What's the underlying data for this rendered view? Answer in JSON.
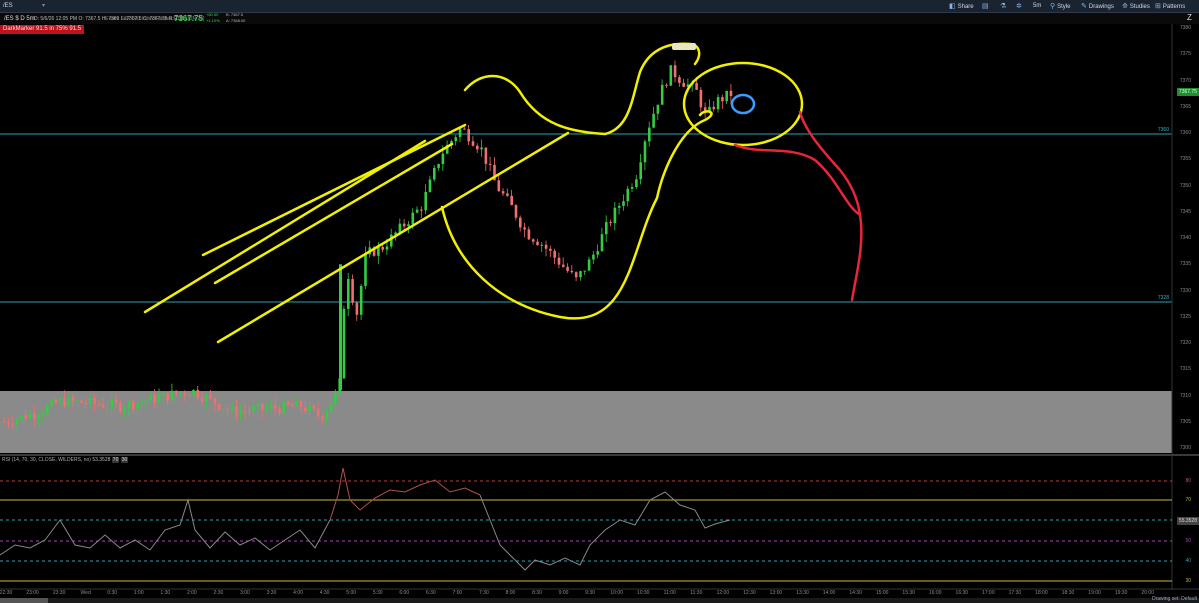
{
  "toolbar": {
    "symbol": "/ES",
    "share": "Share",
    "style": "Style",
    "drawings": "Drawings",
    "studies": "Studies",
    "patterns": "Patterns",
    "timeframe": "5m"
  },
  "header": {
    "symbol": "/ES $ D 5m",
    "ohlc": "D: 5/6/26 12:05 PM   O: 7367.5   H: 7369   L: 7367.5   C: 7367.75   R: 1.5",
    "description": "E-mini S&P 500 Index Futures,ETH [JUN 26]",
    "last_price": "7367.75",
    "change_up": "+80.50",
    "change_down": "+1.10%",
    "bid": "B: 7367.5",
    "ask": "A: 7368.00"
  },
  "study_badge": "DarkMarker 91.5 in 75% 91.5",
  "price_axis": [
    "7380",
    "7375",
    "7370",
    "7365",
    "7360",
    "7355",
    "7350",
    "7345",
    "7340",
    "7335",
    "7330",
    "7325",
    "7320",
    "7315",
    "7310",
    "7305",
    "7300"
  ],
  "level_labels": {
    "upper": "7360",
    "lower": "7328"
  },
  "last_price_badge": "7367.75",
  "rsi": {
    "title": "RSI (14, 70, 30, CLOSE, WILDERS, no)",
    "value": "53.3528",
    "ob": "70",
    "os": "30",
    "axis": [
      "80",
      "70",
      "60",
      "50",
      "40",
      "30"
    ],
    "value_badge": "55.3528"
  },
  "time_axis": [
    "22:30",
    "23:00",
    "23:30",
    "Wed",
    "0:30",
    "1:00",
    "1:30",
    "2:00",
    "2:30",
    "3:00",
    "3:30",
    "4:00",
    "4:30",
    "5:00",
    "5:30",
    "6:00",
    "6:30",
    "7:00",
    "7:30",
    "8:00",
    "8:30",
    "9:00",
    "9:30",
    "10:00",
    "10:30",
    "11:00",
    "11:30",
    "12:00",
    "12:30",
    "13:00",
    "13:30",
    "14:00",
    "14:30",
    "15:00",
    "15:30",
    "16:00",
    "16:30",
    "17:00",
    "17:30",
    "18:00",
    "18:30",
    "19:00",
    "19:30",
    "20:00"
  ],
  "footer": {
    "drawing_set": "Drawing set: Default"
  },
  "colors": {
    "up": "#33cc44",
    "down": "#f07070",
    "level": "#2f9fb0",
    "zone": "#8a8a8a",
    "annotation": "#f0f000",
    "forecast": "#e8253a",
    "circle": "#3b9bff"
  }
}
